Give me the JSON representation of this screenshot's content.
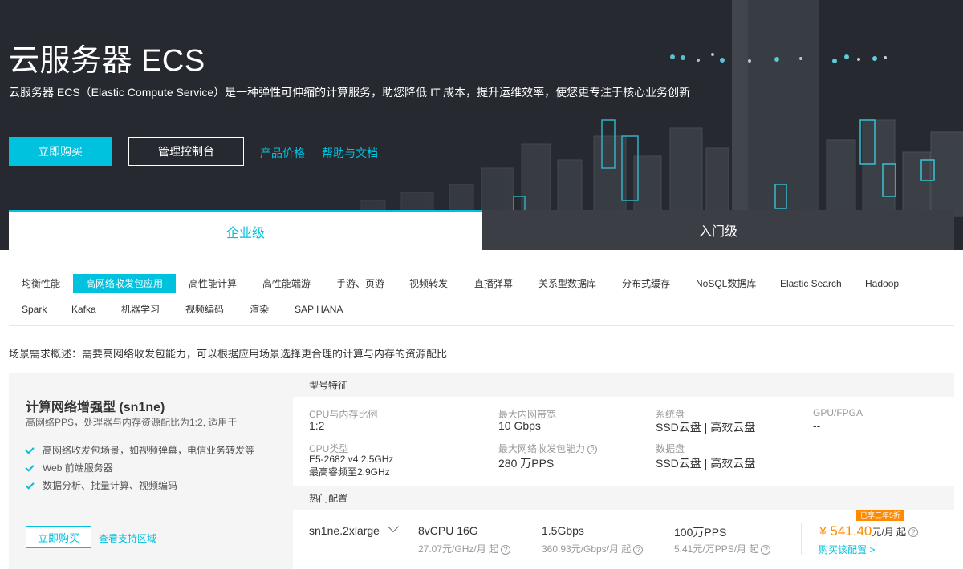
{
  "hero": {
    "title": "云服务器 ECS",
    "description": "云服务器 ECS（Elastic Compute Service）是一种弹性可伸缩的计算服务，助您降低 IT 成本，提升运维效率，使您更专注于核心业务创新",
    "buy_label": "立即购买",
    "console_label": "管理控制台",
    "links": [
      "产品价格",
      "帮助与文档"
    ]
  },
  "tabs": [
    {
      "label": "企业级",
      "active": true
    },
    {
      "label": "入门级",
      "active": false
    }
  ],
  "scenarios": {
    "row1": [
      "均衡性能",
      "高网络收发包应用",
      "高性能计算",
      "高性能端游",
      "手游、页游",
      "视频转发",
      "直播弹幕",
      "关系型数据库",
      "分布式缓存",
      "NoSQL数据库",
      "Elastic Search",
      "Hadoop"
    ],
    "row2": [
      "Spark",
      "Kafka",
      "机器学习",
      "视频编码",
      "渲染",
      "SAP HANA"
    ],
    "active": "高网络收发包应用"
  },
  "scene_description": "场景需求概述：需要高网络收发包能力，可以根据应用场景选择更合理的计算与内存的资源配比",
  "product": {
    "name": "计算网络增强型 (sn1ne)",
    "subtitle": "高网络PPS，处理器与内存资源配比为1:2, 适用于",
    "features": [
      "高网络收发包场景，如视频弹幕，电信业务转发等",
      "Web 前端服务器",
      "数据分析、批量计算、视频编码"
    ],
    "buy_label": "立即购买",
    "region_link": "查看支持区域"
  },
  "specs": {
    "section_title": "型号特征",
    "cpu_mem_ratio": {
      "label": "CPU与内存比例",
      "value": "1:2"
    },
    "intranet_bw": {
      "label": "最大内网带宽",
      "value": "10  Gbps"
    },
    "system_disk": {
      "label": "系统盘",
      "value": "SSD云盘 | 高效云盘"
    },
    "gpu": {
      "label": "GPU/FPGA",
      "value": "--"
    },
    "cpu_type": {
      "label": "CPU类型",
      "value_line1": "E5-2682 v4 2.5GHz",
      "value_line2": "最高睿频至2.9GHz"
    },
    "pps": {
      "label": "最大网络收发包能力",
      "value": "280  万PPS"
    },
    "data_disk": {
      "label": "数据盘",
      "value": "SSD云盘 | 高效云盘"
    }
  },
  "hot_config": {
    "section_title": "热门配置",
    "instance": "sn1ne.2xlarge",
    "cpu_mem": {
      "main": "8vCPU 16G",
      "sub": "27.07元/GHz/月 起"
    },
    "bandwidth": {
      "main": "1.5Gbps",
      "sub": "360.93元/Gbps/月 起"
    },
    "pps": {
      "main": "100万PPS",
      "sub": "5.41元/万PPS/月 起"
    },
    "discount_badge": "已享三年5折",
    "price_symbol": "¥",
    "price": "541.40",
    "price_unit": "元/月 起",
    "buy_link": "购买该配置 >"
  },
  "colors": {
    "accent": "#00c1de",
    "price": "#ff8a00",
    "hero_bg": "#262a30"
  }
}
